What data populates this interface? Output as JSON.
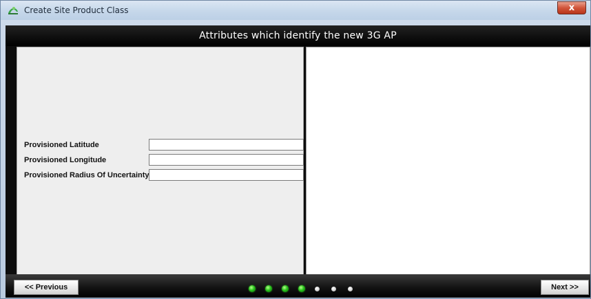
{
  "window": {
    "title": "Create Site Product Class",
    "close_label": "x"
  },
  "header": {
    "title": "Attributes which identify the new 3G AP"
  },
  "form": {
    "fields": [
      {
        "label": "Provisioned Latitude",
        "value": ""
      },
      {
        "label": "Provisioned Longitude",
        "value": ""
      },
      {
        "label": "Provisioned Radius Of Uncertainty",
        "value": ""
      }
    ]
  },
  "footer": {
    "prev_label": "<< Previous",
    "next_label": "Next >>",
    "progress": {
      "completed_steps": 4,
      "total_steps": 7
    }
  },
  "colors": {
    "active_step": "#27c21b",
    "inactive_step": "#cfcfcf",
    "header_bg": "#000000"
  }
}
